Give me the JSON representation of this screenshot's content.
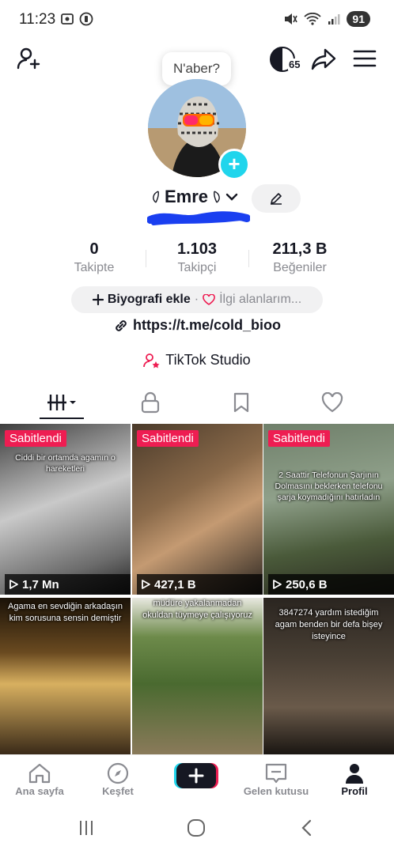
{
  "status": {
    "time": "11:23",
    "battery": "91"
  },
  "top": {
    "bubble_text": "N'aber?",
    "coin_count": "65"
  },
  "profile": {
    "name": "Emre",
    "stats": [
      {
        "value": "0",
        "label": "Takipte"
      },
      {
        "value": "1.103",
        "label": "Takipçi"
      },
      {
        "value": "211,3 B",
        "label": "Beğeniler"
      }
    ],
    "bio_button": "Biyografi ekle",
    "bio_separator": "·",
    "interests_button": "İlgi alanlarım...",
    "link": "https://t.me/cold_bioo",
    "studio": "TikTok Studio"
  },
  "grid": [
    {
      "pinned": "Sabitlendi",
      "caption": "Ciddi bir ortamda agamın o hareketleri",
      "views": "1,7 Mn"
    },
    {
      "pinned": "Sabitlendi",
      "caption": "",
      "views": "427,1 B"
    },
    {
      "pinned": "Sabitlendi",
      "caption": "2 Saattir Telefonun Şarjının Dolmasını beklerken telefonu şarja koymadığını hatırladın",
      "views": "250,6 B"
    },
    {
      "pinned": "",
      "caption": "Agama en sevdiğin arkadaşın kim sorusuna sensin demiştir",
      "views": ""
    },
    {
      "pinned": "",
      "caption": "müdüre yakalanmadan okuldan tüymeye çalışıyoruz",
      "views": ""
    },
    {
      "pinned": "",
      "caption": "3847274 yardım istediğim agam benden bir defa bişey isteyince",
      "views": ""
    }
  ],
  "nav": {
    "home": "Ana sayfa",
    "discover": "Keşfet",
    "inbox": "Gelen kutusu",
    "profile": "Profil"
  },
  "colors": {
    "accent_pink": "#ee1d52",
    "accent_cyan": "#20d5ec",
    "blue_scribble": "#1a3ff0"
  }
}
